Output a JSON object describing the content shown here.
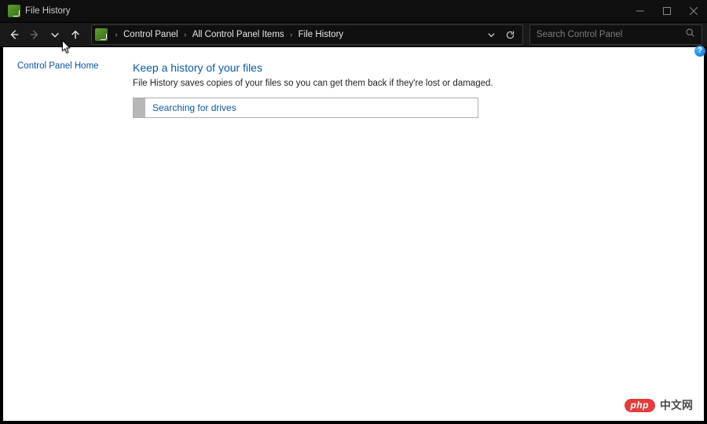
{
  "window": {
    "title": "File History"
  },
  "nav": {
    "breadcrumb": [
      "Control Panel",
      "All Control Panel Items",
      "File History"
    ],
    "search_placeholder": "Search Control Panel"
  },
  "sidebar": {
    "home_link": "Control Panel Home"
  },
  "main": {
    "heading": "Keep a history of your files",
    "description": "File History saves copies of your files so you can get them back if they're lost or damaged.",
    "status": "Searching for drives"
  },
  "help": {
    "badge": "?"
  },
  "watermark": {
    "pill": "php",
    "text": "中文网"
  }
}
